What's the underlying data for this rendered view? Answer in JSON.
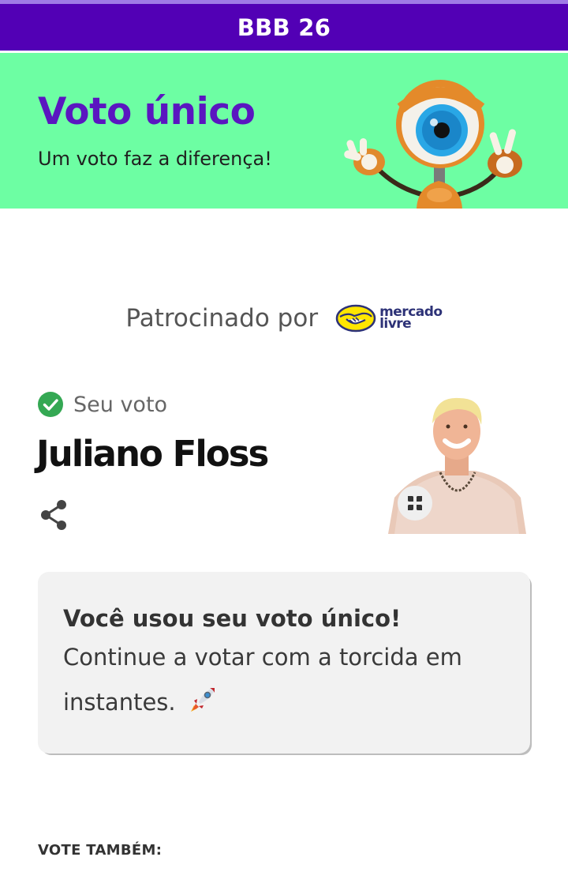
{
  "header": {
    "title": "BBB 26",
    "bar_color": "#5200b5"
  },
  "hero": {
    "title": "Voto único",
    "subtitle": "Um voto faz a diferença!",
    "background_color": "#6dfea3",
    "mascot_icon": "big-brother-eye-mascot"
  },
  "sponsor": {
    "label": "Patrocinado por",
    "logo_line1": "mercado",
    "logo_line2": "livre"
  },
  "vote": {
    "status_label": "Seu voto",
    "status_icon": "check-circle-icon",
    "status_color": "#34a853",
    "candidate_name": "Juliano Floss",
    "share_icon": "share-icon",
    "expand_icon": "expand-icon"
  },
  "info_card": {
    "title": "Você usou seu voto único!",
    "body": "Continue a votar com a torcida em instantes.",
    "emoji": "rocket"
  },
  "footer": {
    "vote_also_label": "VOTE TAMBÉM:"
  }
}
